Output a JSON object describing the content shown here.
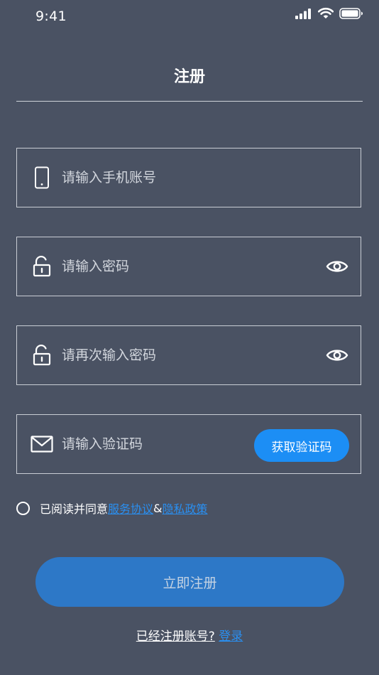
{
  "status_bar": {
    "time": "9:41",
    "icons": [
      "signal-icon",
      "wifi-icon",
      "battery-icon"
    ]
  },
  "page": {
    "title": "注册"
  },
  "form": {
    "phone": {
      "placeholder": "请输入手机账号",
      "value": "",
      "icon": "phone-icon"
    },
    "password": {
      "placeholder": "请输入密码",
      "value": "",
      "icon": "lock-icon",
      "toggle_icon": "eye-icon"
    },
    "confirm_password": {
      "placeholder": "请再次输入密码",
      "value": "",
      "icon": "lock-icon",
      "toggle_icon": "eye-icon"
    },
    "code": {
      "placeholder": "请输入验证码",
      "value": "",
      "icon": "mail-icon",
      "button_label": "获取验证码"
    }
  },
  "agreement": {
    "prefix": "已阅读并同意",
    "terms_link": "服务协议",
    "separator": "&",
    "privacy_link": "隐私政策"
  },
  "actions": {
    "register_label": "立即注册",
    "login_prompt": "已经注册账号?",
    "login_link": "登录"
  },
  "colors": {
    "background": "#4a5263",
    "accent": "#1c8ef5",
    "register_button": "#2d78c7",
    "link": "#2a8ff0"
  }
}
